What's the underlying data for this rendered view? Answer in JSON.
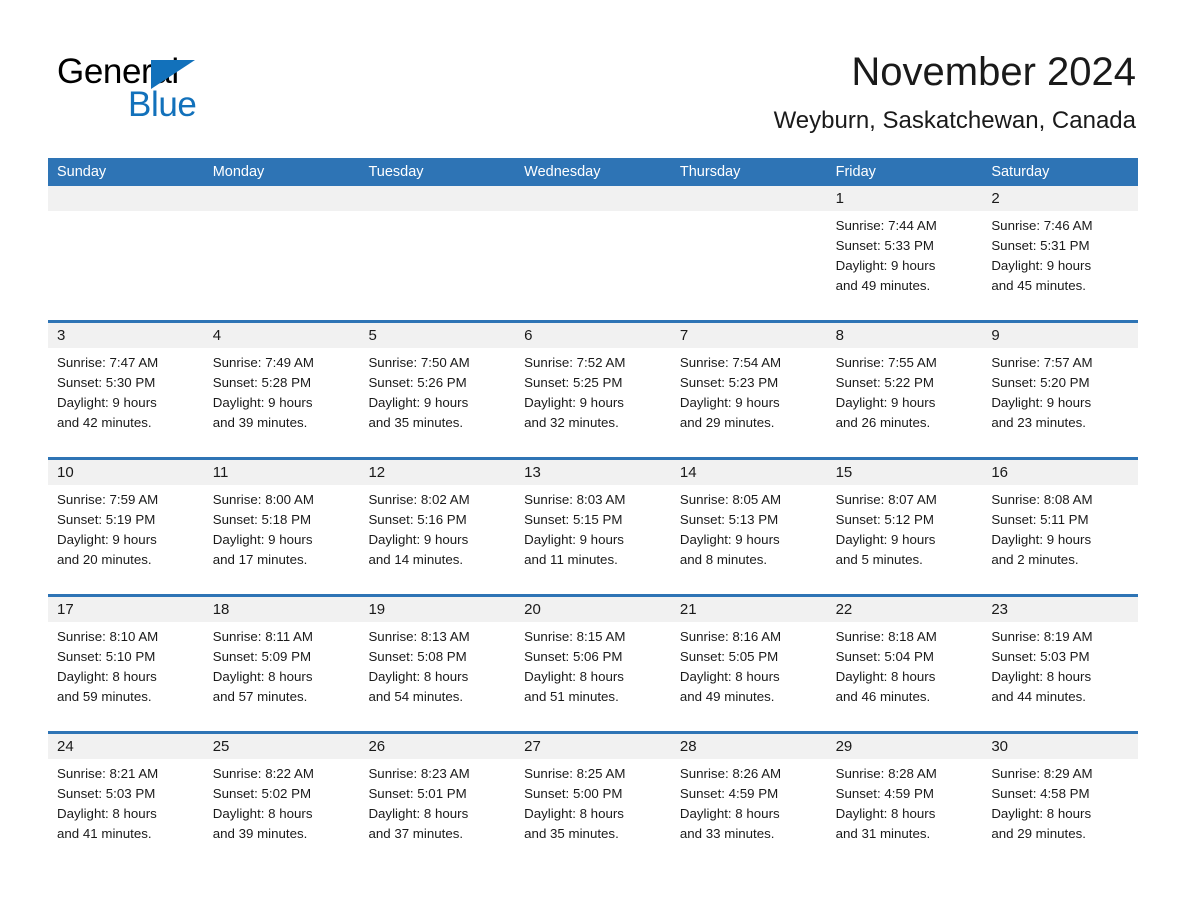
{
  "brand": {
    "name_part1": "General",
    "name_part2": "Blue",
    "triangle_color": "#1271bb"
  },
  "header": {
    "title": "November 2024",
    "location": "Weyburn, Saskatchewan, Canada",
    "accent_color": "#2e74b5",
    "band_color": "#f1f1f1"
  },
  "weekdays": [
    "Sunday",
    "Monday",
    "Tuesday",
    "Wednesday",
    "Thursday",
    "Friday",
    "Saturday"
  ],
  "weeks": [
    [
      {
        "day": "",
        "sunrise": "",
        "sunset": "",
        "daylight_line1": "",
        "daylight_line2": ""
      },
      {
        "day": "",
        "sunrise": "",
        "sunset": "",
        "daylight_line1": "",
        "daylight_line2": ""
      },
      {
        "day": "",
        "sunrise": "",
        "sunset": "",
        "daylight_line1": "",
        "daylight_line2": ""
      },
      {
        "day": "",
        "sunrise": "",
        "sunset": "",
        "daylight_line1": "",
        "daylight_line2": ""
      },
      {
        "day": "",
        "sunrise": "",
        "sunset": "",
        "daylight_line1": "",
        "daylight_line2": ""
      },
      {
        "day": "1",
        "sunrise": "Sunrise: 7:44 AM",
        "sunset": "Sunset: 5:33 PM",
        "daylight_line1": "Daylight: 9 hours",
        "daylight_line2": "and 49 minutes."
      },
      {
        "day": "2",
        "sunrise": "Sunrise: 7:46 AM",
        "sunset": "Sunset: 5:31 PM",
        "daylight_line1": "Daylight: 9 hours",
        "daylight_line2": "and 45 minutes."
      }
    ],
    [
      {
        "day": "3",
        "sunrise": "Sunrise: 7:47 AM",
        "sunset": "Sunset: 5:30 PM",
        "daylight_line1": "Daylight: 9 hours",
        "daylight_line2": "and 42 minutes."
      },
      {
        "day": "4",
        "sunrise": "Sunrise: 7:49 AM",
        "sunset": "Sunset: 5:28 PM",
        "daylight_line1": "Daylight: 9 hours",
        "daylight_line2": "and 39 minutes."
      },
      {
        "day": "5",
        "sunrise": "Sunrise: 7:50 AM",
        "sunset": "Sunset: 5:26 PM",
        "daylight_line1": "Daylight: 9 hours",
        "daylight_line2": "and 35 minutes."
      },
      {
        "day": "6",
        "sunrise": "Sunrise: 7:52 AM",
        "sunset": "Sunset: 5:25 PM",
        "daylight_line1": "Daylight: 9 hours",
        "daylight_line2": "and 32 minutes."
      },
      {
        "day": "7",
        "sunrise": "Sunrise: 7:54 AM",
        "sunset": "Sunset: 5:23 PM",
        "daylight_line1": "Daylight: 9 hours",
        "daylight_line2": "and 29 minutes."
      },
      {
        "day": "8",
        "sunrise": "Sunrise: 7:55 AM",
        "sunset": "Sunset: 5:22 PM",
        "daylight_line1": "Daylight: 9 hours",
        "daylight_line2": "and 26 minutes."
      },
      {
        "day": "9",
        "sunrise": "Sunrise: 7:57 AM",
        "sunset": "Sunset: 5:20 PM",
        "daylight_line1": "Daylight: 9 hours",
        "daylight_line2": "and 23 minutes."
      }
    ],
    [
      {
        "day": "10",
        "sunrise": "Sunrise: 7:59 AM",
        "sunset": "Sunset: 5:19 PM",
        "daylight_line1": "Daylight: 9 hours",
        "daylight_line2": "and 20 minutes."
      },
      {
        "day": "11",
        "sunrise": "Sunrise: 8:00 AM",
        "sunset": "Sunset: 5:18 PM",
        "daylight_line1": "Daylight: 9 hours",
        "daylight_line2": "and 17 minutes."
      },
      {
        "day": "12",
        "sunrise": "Sunrise: 8:02 AM",
        "sunset": "Sunset: 5:16 PM",
        "daylight_line1": "Daylight: 9 hours",
        "daylight_line2": "and 14 minutes."
      },
      {
        "day": "13",
        "sunrise": "Sunrise: 8:03 AM",
        "sunset": "Sunset: 5:15 PM",
        "daylight_line1": "Daylight: 9 hours",
        "daylight_line2": "and 11 minutes."
      },
      {
        "day": "14",
        "sunrise": "Sunrise: 8:05 AM",
        "sunset": "Sunset: 5:13 PM",
        "daylight_line1": "Daylight: 9 hours",
        "daylight_line2": "and 8 minutes."
      },
      {
        "day": "15",
        "sunrise": "Sunrise: 8:07 AM",
        "sunset": "Sunset: 5:12 PM",
        "daylight_line1": "Daylight: 9 hours",
        "daylight_line2": "and 5 minutes."
      },
      {
        "day": "16",
        "sunrise": "Sunrise: 8:08 AM",
        "sunset": "Sunset: 5:11 PM",
        "daylight_line1": "Daylight: 9 hours",
        "daylight_line2": "and 2 minutes."
      }
    ],
    [
      {
        "day": "17",
        "sunrise": "Sunrise: 8:10 AM",
        "sunset": "Sunset: 5:10 PM",
        "daylight_line1": "Daylight: 8 hours",
        "daylight_line2": "and 59 minutes."
      },
      {
        "day": "18",
        "sunrise": "Sunrise: 8:11 AM",
        "sunset": "Sunset: 5:09 PM",
        "daylight_line1": "Daylight: 8 hours",
        "daylight_line2": "and 57 minutes."
      },
      {
        "day": "19",
        "sunrise": "Sunrise: 8:13 AM",
        "sunset": "Sunset: 5:08 PM",
        "daylight_line1": "Daylight: 8 hours",
        "daylight_line2": "and 54 minutes."
      },
      {
        "day": "20",
        "sunrise": "Sunrise: 8:15 AM",
        "sunset": "Sunset: 5:06 PM",
        "daylight_line1": "Daylight: 8 hours",
        "daylight_line2": "and 51 minutes."
      },
      {
        "day": "21",
        "sunrise": "Sunrise: 8:16 AM",
        "sunset": "Sunset: 5:05 PM",
        "daylight_line1": "Daylight: 8 hours",
        "daylight_line2": "and 49 minutes."
      },
      {
        "day": "22",
        "sunrise": "Sunrise: 8:18 AM",
        "sunset": "Sunset: 5:04 PM",
        "daylight_line1": "Daylight: 8 hours",
        "daylight_line2": "and 46 minutes."
      },
      {
        "day": "23",
        "sunrise": "Sunrise: 8:19 AM",
        "sunset": "Sunset: 5:03 PM",
        "daylight_line1": "Daylight: 8 hours",
        "daylight_line2": "and 44 minutes."
      }
    ],
    [
      {
        "day": "24",
        "sunrise": "Sunrise: 8:21 AM",
        "sunset": "Sunset: 5:03 PM",
        "daylight_line1": "Daylight: 8 hours",
        "daylight_line2": "and 41 minutes."
      },
      {
        "day": "25",
        "sunrise": "Sunrise: 8:22 AM",
        "sunset": "Sunset: 5:02 PM",
        "daylight_line1": "Daylight: 8 hours",
        "daylight_line2": "and 39 minutes."
      },
      {
        "day": "26",
        "sunrise": "Sunrise: 8:23 AM",
        "sunset": "Sunset: 5:01 PM",
        "daylight_line1": "Daylight: 8 hours",
        "daylight_line2": "and 37 minutes."
      },
      {
        "day": "27",
        "sunrise": "Sunrise: 8:25 AM",
        "sunset": "Sunset: 5:00 PM",
        "daylight_line1": "Daylight: 8 hours",
        "daylight_line2": "and 35 minutes."
      },
      {
        "day": "28",
        "sunrise": "Sunrise: 8:26 AM",
        "sunset": "Sunset: 4:59 PM",
        "daylight_line1": "Daylight: 8 hours",
        "daylight_line2": "and 33 minutes."
      },
      {
        "day": "29",
        "sunrise": "Sunrise: 8:28 AM",
        "sunset": "Sunset: 4:59 PM",
        "daylight_line1": "Daylight: 8 hours",
        "daylight_line2": "and 31 minutes."
      },
      {
        "day": "30",
        "sunrise": "Sunrise: 8:29 AM",
        "sunset": "Sunset: 4:58 PM",
        "daylight_line1": "Daylight: 8 hours",
        "daylight_line2": "and 29 minutes."
      }
    ]
  ]
}
